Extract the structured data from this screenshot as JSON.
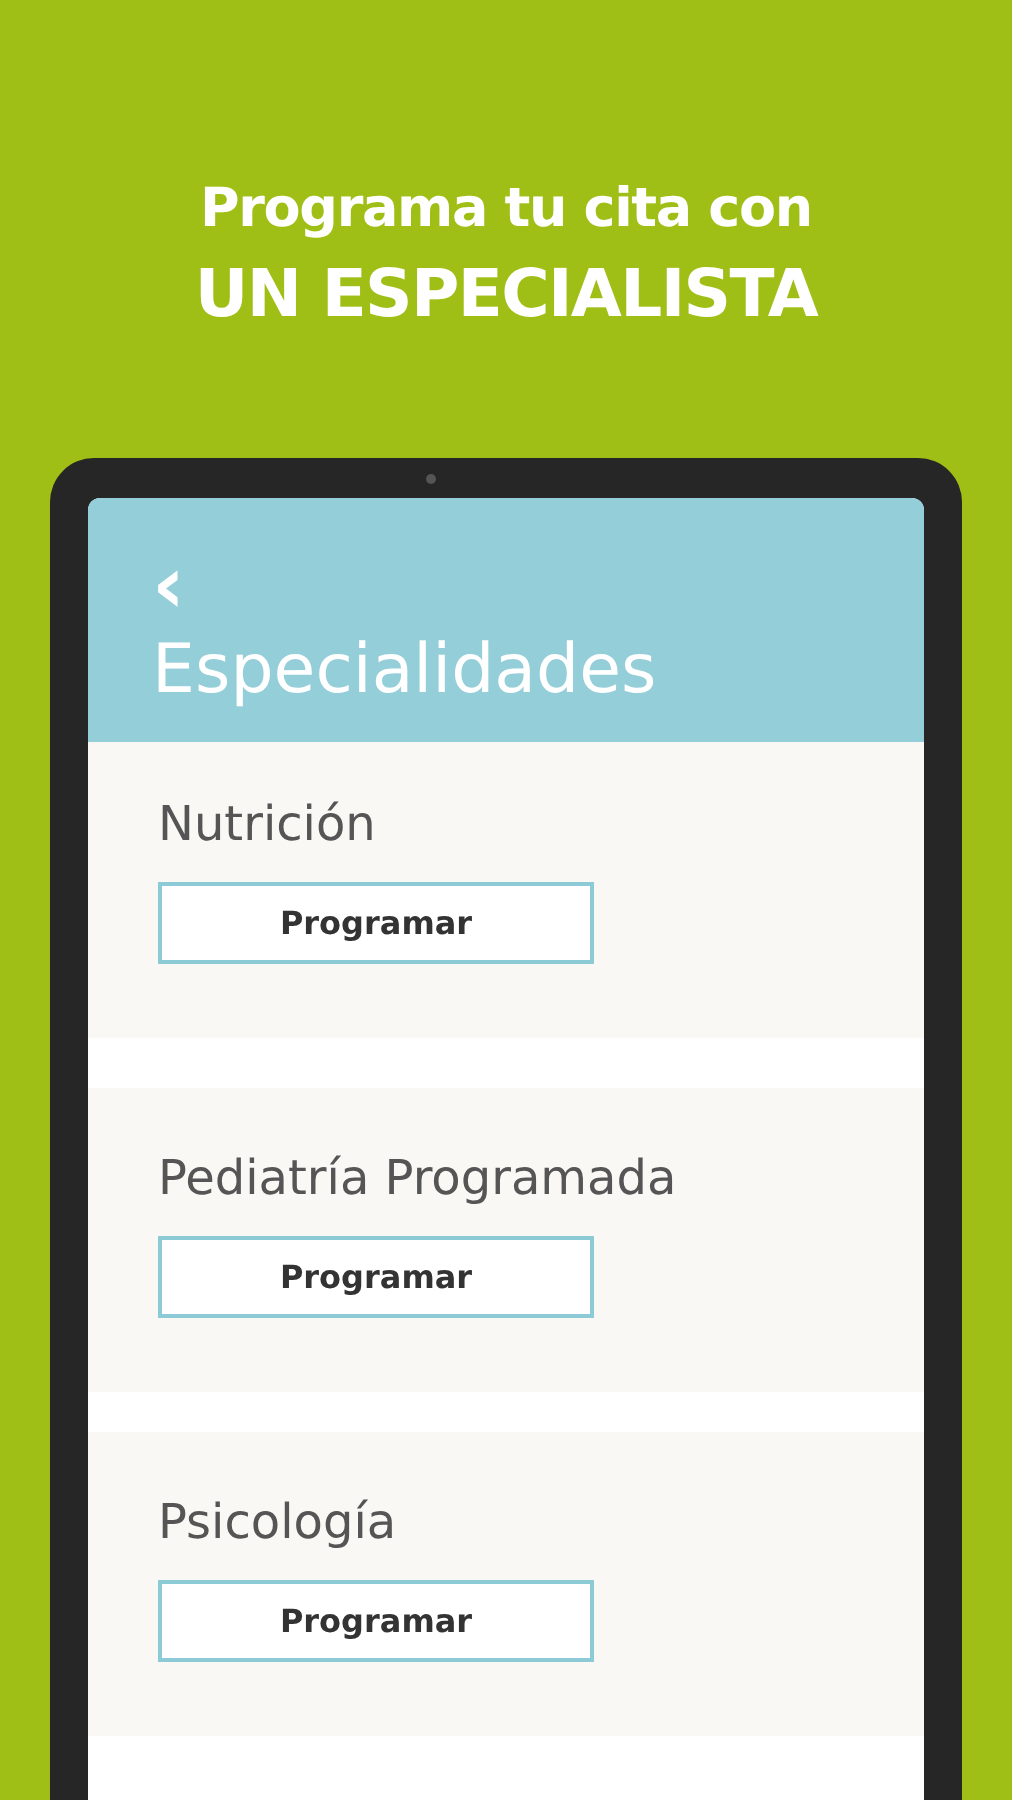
{
  "promo": {
    "line_1": "Programa tu cita con",
    "line_2": "UN ESPECIALISTA"
  },
  "screen": {
    "back_icon": "‹",
    "title": "Especialidades",
    "specialties": [
      {
        "name": "Nutrición",
        "button": "Programar"
      },
      {
        "name": "Pediatría Programada",
        "button": "Programar"
      },
      {
        "name": "Psicología",
        "button": "Programar"
      }
    ]
  }
}
